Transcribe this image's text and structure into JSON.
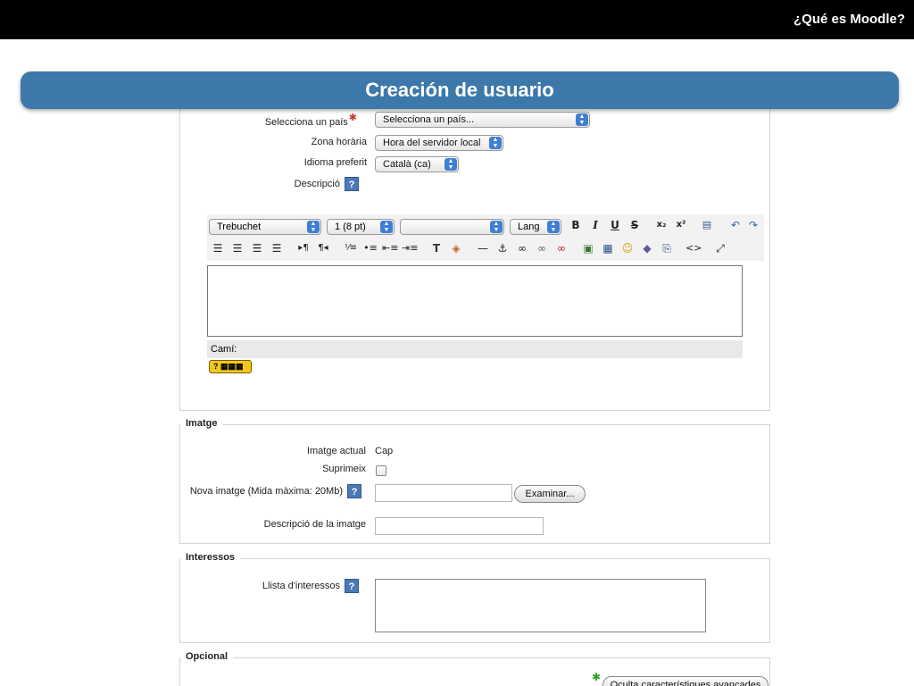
{
  "header": {
    "title": "¿Qué es Moodle?"
  },
  "banner": {
    "title": "Creación de usuario"
  },
  "profile": {
    "country_label": "Selecciona un país",
    "country_value": "Selecciona un país...",
    "timezone_label": "Zona horària",
    "timezone_value": "Hora del servidor local",
    "language_label": "Idioma preferit",
    "language_value": "Català (ca)",
    "description_label": "Descripció"
  },
  "editor": {
    "font_value": "Trebuchet",
    "size_value": "1 (8 pt)",
    "format_value": "",
    "lang_value": "Lang",
    "path_label": "Camí:",
    "icons_row1": [
      "bold-icon",
      "italic-icon",
      "underline-icon",
      "strikethrough-icon",
      "subscript-icon",
      "superscript-icon",
      "clean-word-icon",
      "undo-icon",
      "redo-icon"
    ],
    "icons_row2": [
      "align-left-icon",
      "align-center-icon",
      "align-right-icon",
      "justify-icon",
      "ltr-icon",
      "rtl-icon",
      "ordered-list-icon",
      "unordered-list-icon",
      "outdent-icon",
      "indent-icon",
      "text-color-icon",
      "background-color-icon",
      "horizontal-rule-icon",
      "anchor-icon",
      "link-icon",
      "unlink-icon",
      "nolink-icon",
      "image-icon",
      "table-icon",
      "smiley-icon",
      "special-char-icon",
      "search-replace-icon",
      "html-source-icon",
      "fullscreen-icon"
    ]
  },
  "image_section": {
    "legend": "Imatge",
    "current_label": "Imatge actual",
    "current_value": "Cap",
    "delete_label": "Suprimeix",
    "new_label": "Nova imatge (Mida màxima: 20Mb)",
    "browse_button": "Examinar...",
    "description_label": "Descripció de la imatge"
  },
  "interests_section": {
    "legend": "Interessos",
    "list_label": "Llista d'interessos"
  },
  "optional_section": {
    "legend": "Opcional",
    "advanced_button": "Oculta característiques avançades"
  },
  "help_icon_text": "?"
}
